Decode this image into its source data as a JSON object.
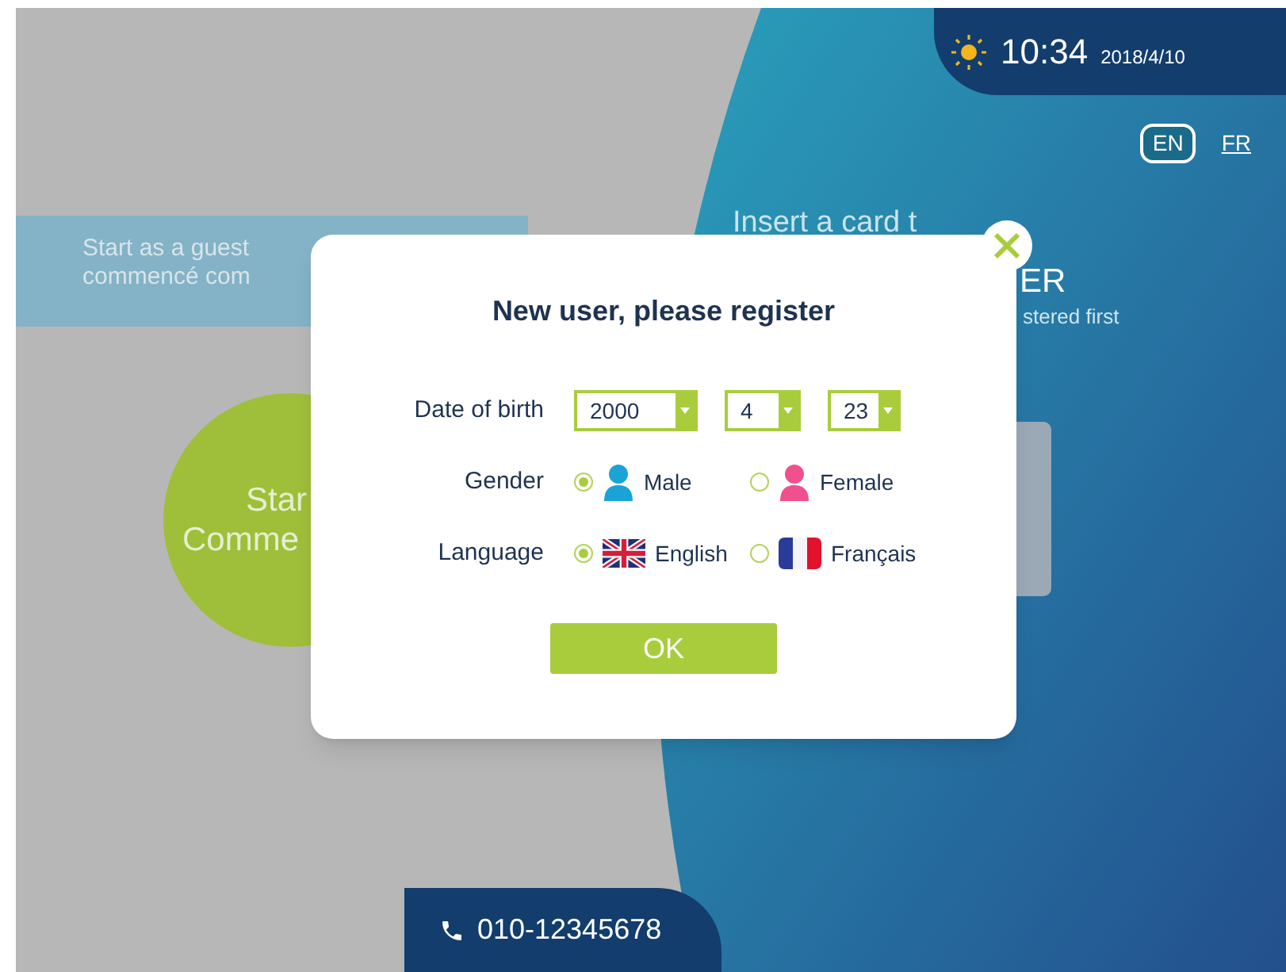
{
  "status_bar": {
    "time": "10:34",
    "date": "2018/4/10"
  },
  "language_switch": [
    {
      "label": "EN",
      "selected": true
    },
    {
      "label": "FR",
      "selected": false
    }
  ],
  "guest_panel": {
    "lines": [
      "Start as a guest",
      "commencé com"
    ]
  },
  "guest_button": {
    "lines": [
      "Star",
      "Comme"
    ]
  },
  "card_panel": {
    "title": "Insert a card t",
    "subtitle": "ER",
    "note": "stered first"
  },
  "dialog": {
    "title": "New user, please register",
    "fields": [
      {
        "kind": "date",
        "label": "Date of birth",
        "selects": [
          {
            "value": "2000"
          },
          {
            "value": "4"
          },
          {
            "value": "23"
          }
        ]
      },
      {
        "kind": "radio",
        "label": "Gender",
        "options": [
          {
            "label": "Male",
            "selected": true
          },
          {
            "label": "Female",
            "selected": false
          }
        ]
      },
      {
        "kind": "radio",
        "label": "Language",
        "options": [
          {
            "label": "English",
            "selected": true
          },
          {
            "label": "Français",
            "selected": false
          }
        ]
      }
    ],
    "ok_button": "OK"
  },
  "phone": "010-12345678"
}
